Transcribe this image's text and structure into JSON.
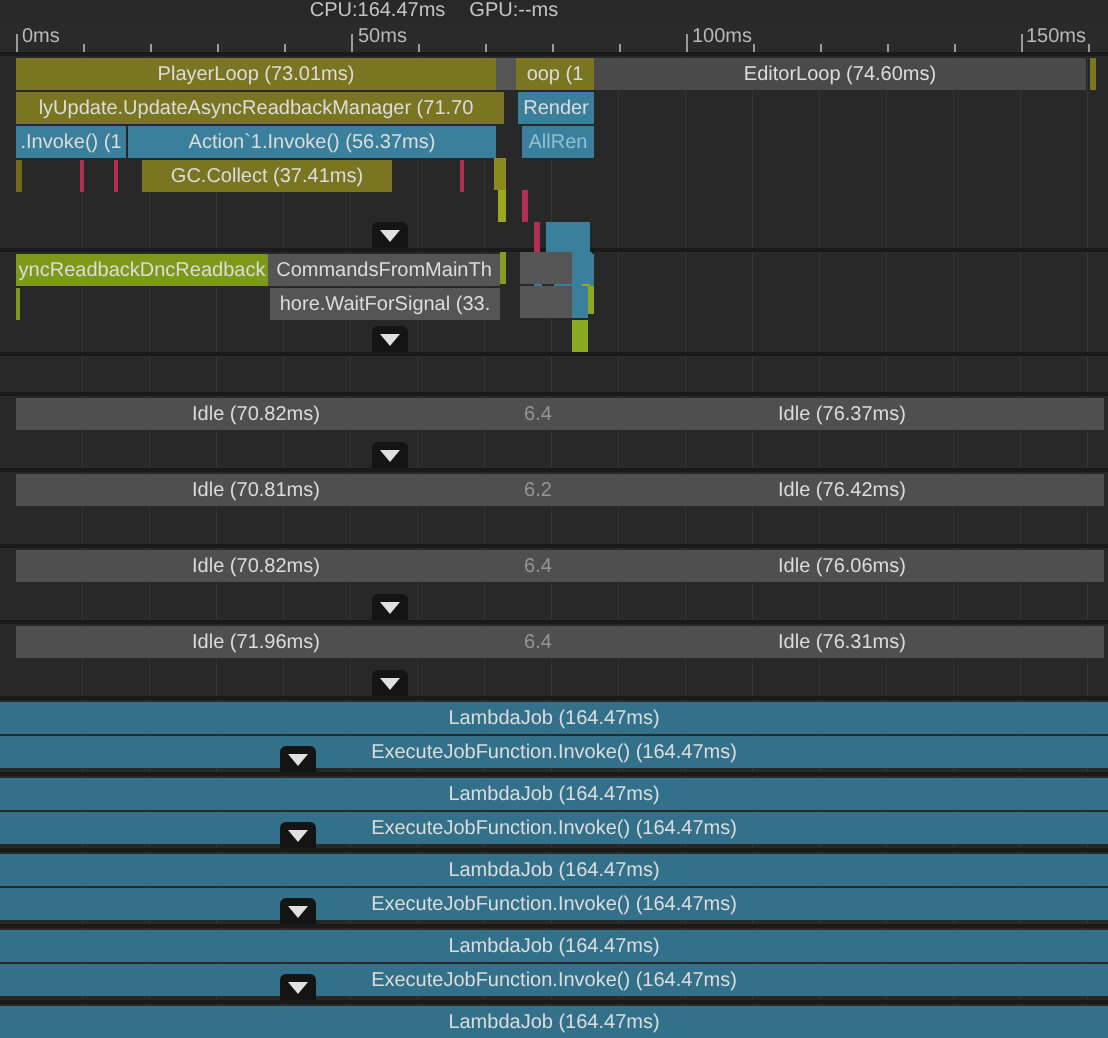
{
  "header": {
    "cpu": "CPU:164.47ms",
    "gpu": "GPU:--ms"
  },
  "ruler": {
    "labels": [
      "0ms",
      "50ms",
      "100ms",
      "150ms"
    ]
  },
  "lanes": [
    {
      "kind": "main",
      "expander": true,
      "rows": [
        [
          {
            "label": "PlayerLoop (73.01ms)",
            "color": "#7a7520",
            "dimmed": false
          },
          {
            "color": "#555555"
          },
          {
            "label": "oop (1",
            "color": "#7a7520",
            "dimmed": false
          },
          {
            "label": "EditorLoop (74.60ms)",
            "color": "#4a4a4a",
            "dimmed": false
          },
          {
            "color": "#7a7520"
          }
        ],
        [
          {
            "label": "lyUpdate.UpdateAsyncReadbackManager (71.70",
            "color": "#7a7520",
            "dimmed": false
          },
          {
            "color": "#7a7520"
          },
          {
            "label": "Render",
            "color": "#3a7f9b",
            "dimmed": false
          }
        ],
        [
          {
            "label": ".Invoke() (1",
            "color": "#3a7f9b",
            "dimmed": false
          },
          {
            "label": "Action`1.Invoke() (56.37ms)",
            "color": "#3a7f9b",
            "dimmed": false
          },
          {
            "label": "AllRen",
            "color": "#3a7f9b",
            "dimmed": true
          }
        ],
        [
          {
            "label": "GC.Collect (37.41ms)",
            "color": "#7a7520",
            "dimmed": false
          },
          {
            "color": "#6e6a1c"
          },
          {
            "color": "#b0304f"
          },
          {
            "color": "#b0304f"
          },
          {
            "color": "#b0304f"
          }
        ]
      ]
    },
    {
      "kind": "render",
      "expander": true,
      "rows": [
        [
          {
            "label": "yncReadbackDncReadback",
            "color": "#7d9919",
            "dimmed": false
          },
          {
            "label": "CommandsFromMainTh",
            "color": "#555555",
            "dimmed": false
          }
        ],
        [
          {
            "color": "#7d9919"
          },
          {
            "label": "hore.WaitForSignal (33.",
            "color": "#555555",
            "dimmed": false
          }
        ]
      ]
    },
    {
      "kind": "empty",
      "expander": false
    },
    {
      "kind": "idle",
      "expander": true,
      "rows": [
        [
          {
            "label": "Idle (70.82ms)",
            "color": "#4f4f4f",
            "dimmed": false
          },
          {
            "label": "6.4",
            "color": "#4f4f4f",
            "dimmed": true
          },
          {
            "label": "Idle (76.37ms)",
            "color": "#4f4f4f",
            "dimmed": false
          }
        ]
      ]
    },
    {
      "kind": "idle",
      "expander": false,
      "rows": [
        [
          {
            "label": "Idle (70.81ms)",
            "color": "#4f4f4f",
            "dimmed": false
          },
          {
            "label": "6.2",
            "color": "#4f4f4f",
            "dimmed": true
          },
          {
            "label": "Idle (76.42ms)",
            "color": "#4f4f4f",
            "dimmed": false
          }
        ]
      ]
    },
    {
      "kind": "idle",
      "expander": true,
      "rows": [
        [
          {
            "label": "Idle (70.82ms)",
            "color": "#4f4f4f",
            "dimmed": false
          },
          {
            "label": "6.4",
            "color": "#4f4f4f",
            "dimmed": true
          },
          {
            "label": "Idle (76.06ms)",
            "color": "#4f4f4f",
            "dimmed": false
          }
        ]
      ]
    },
    {
      "kind": "idle",
      "expander": true,
      "rows": [
        [
          {
            "label": "Idle (71.96ms)",
            "color": "#4f4f4f",
            "dimmed": false
          },
          {
            "label": "6.4",
            "color": "#4f4f4f",
            "dimmed": true
          },
          {
            "label": "Idle (76.31ms)",
            "color": "#4f4f4f",
            "dimmed": false
          }
        ]
      ]
    },
    {
      "kind": "job",
      "expander": true,
      "rows": [
        [
          {
            "label": "LambdaJob (164.47ms)",
            "color": "#33718b",
            "dimmed": false
          }
        ],
        [
          {
            "label": "ExecuteJobFunction.Invoke() (164.47ms)",
            "color": "#33718b",
            "dimmed": false
          }
        ]
      ]
    },
    {
      "kind": "job",
      "expander": true,
      "rows": [
        [
          {
            "label": "LambdaJob (164.47ms)",
            "color": "#33718b",
            "dimmed": false
          }
        ],
        [
          {
            "label": "ExecuteJobFunction.Invoke() (164.47ms)",
            "color": "#33718b",
            "dimmed": false
          }
        ]
      ]
    },
    {
      "kind": "job",
      "expander": true,
      "rows": [
        [
          {
            "label": "LambdaJob (164.47ms)",
            "color": "#33718b",
            "dimmed": false
          }
        ],
        [
          {
            "label": "ExecuteJobFunction.Invoke() (164.47ms)",
            "color": "#33718b",
            "dimmed": false
          }
        ]
      ]
    },
    {
      "kind": "job",
      "expander": true,
      "rows": [
        [
          {
            "label": "LambdaJob (164.47ms)",
            "color": "#33718b",
            "dimmed": false
          }
        ],
        [
          {
            "label": "ExecuteJobFunction.Invoke() (164.47ms)",
            "color": "#33718b",
            "dimmed": false
          }
        ]
      ]
    },
    {
      "kind": "job",
      "expander": false,
      "rows": [
        [
          {
            "label": "LambdaJob (164.47ms)",
            "color": "#33718b",
            "dimmed": false
          }
        ]
      ]
    }
  ]
}
